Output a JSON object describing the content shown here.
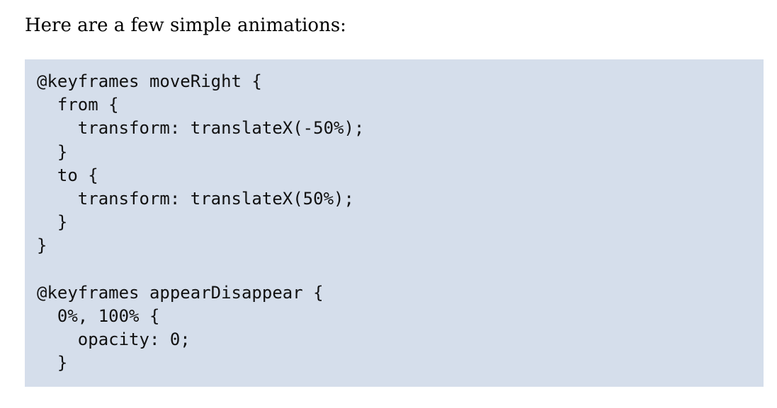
{
  "intro": "Here are a few simple animations:",
  "code_lines": [
    "@keyframes moveRight {",
    "  from {",
    "    transform: translateX(-50%);",
    "  }",
    "  to {",
    "    transform: translateX(50%);",
    "  }",
    "}",
    "",
    "@keyframes appearDisappear {",
    "  0%, 100% {",
    "    opacity: 0;",
    "  }"
  ]
}
